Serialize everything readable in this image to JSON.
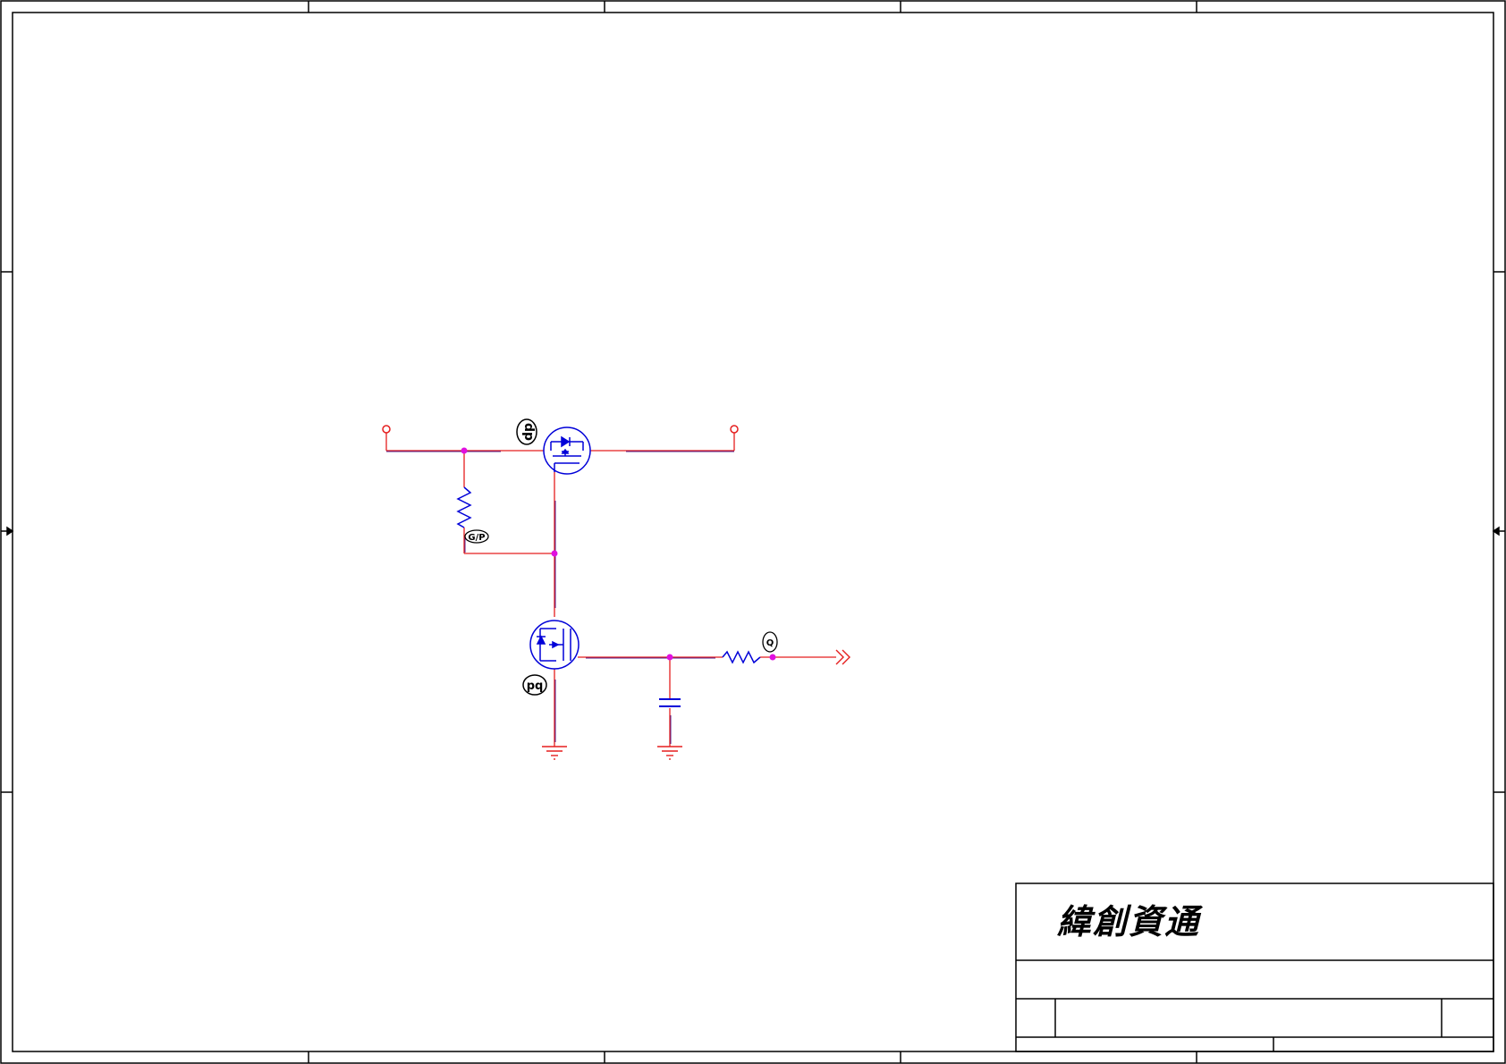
{
  "title_block": {
    "company_logo": "緯創資通"
  },
  "refdes_bubbles": {
    "q_top": "dp",
    "r_upper": "G/P",
    "q_bottom": "pq",
    "r_output": "Q"
  },
  "colors": {
    "wire": "#e51e1e",
    "net_overlay": "#33007f",
    "component": "#0000d8",
    "junction": "#e010e0",
    "frame": "#000000"
  }
}
